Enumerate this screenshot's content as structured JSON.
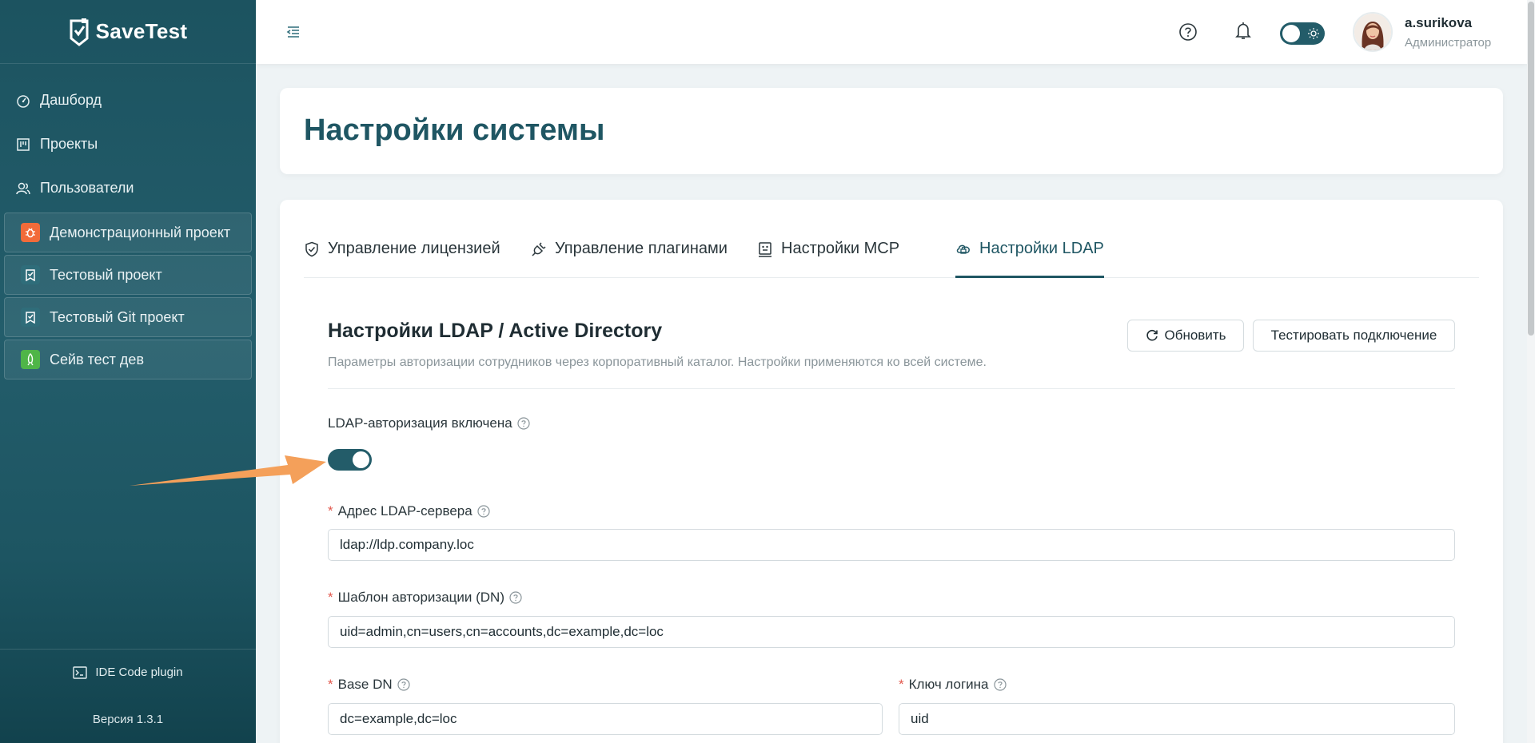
{
  "brand": {
    "name": "SaveTest"
  },
  "sidebar": {
    "nav": [
      {
        "label": "Дашборд",
        "icon": "dashboard-icon"
      },
      {
        "label": "Проекты",
        "icon": "board-icon"
      },
      {
        "label": "Пользователи",
        "icon": "users-icon"
      }
    ],
    "projects": [
      {
        "label": "Демонстрационный проект",
        "icon": "bug-icon",
        "color": "#f26b3a"
      },
      {
        "label": "Тестовый проект",
        "icon": "checklist-icon",
        "color": "#2f6d7a"
      },
      {
        "label": "Тестовый Git проект",
        "icon": "checklist-icon",
        "color": "#2f6d7a"
      },
      {
        "label": "Сейв тест дев",
        "icon": "rocket-icon",
        "color": "#4fb548"
      }
    ],
    "footer": {
      "ide_label": "IDE Code plugin",
      "version": "Версия 1.3.1"
    }
  },
  "topbar": {
    "user": {
      "name": "a.surikova",
      "role": "Администратор"
    }
  },
  "page": {
    "title": "Настройки системы"
  },
  "tabs": [
    {
      "label": "Управление лицензией",
      "icon": "shield-check-icon",
      "active": false
    },
    {
      "label": "Управление плагинами",
      "icon": "plug-icon",
      "active": false
    },
    {
      "label": "Настройки MCP",
      "icon": "robot-icon",
      "active": false
    },
    {
      "label": "Настройки LDAP",
      "icon": "cloud-icon",
      "active": true
    }
  ],
  "ldap": {
    "title": "Настройки LDAP / Active Directory",
    "description": "Параметры авторизации сотрудников через корпоративный каталог. Настройки применяются ко всей системе.",
    "refresh_label": "Обновить",
    "test_label": "Тестировать подключение",
    "enabled_label": "LDAP-авторизация включена",
    "enabled": true,
    "required_mark": "*",
    "server_label": "Адрес LDAP-сервера",
    "server_value": "ldap://ldp.company.loc",
    "dn_label": "Шаблон авторизации (DN)",
    "dn_value": "uid=admin,cn=users,cn=accounts,dc=example,dc=loc",
    "base_dn_label": "Base DN",
    "base_dn_value": "dc=example,dc=loc",
    "login_key_label": "Ключ логина",
    "login_key_value": "uid"
  },
  "colors": {
    "accent": "#1f5663",
    "sidebar": "#1c5360",
    "required": "#e2574c",
    "arrow": "#f4a05a"
  }
}
